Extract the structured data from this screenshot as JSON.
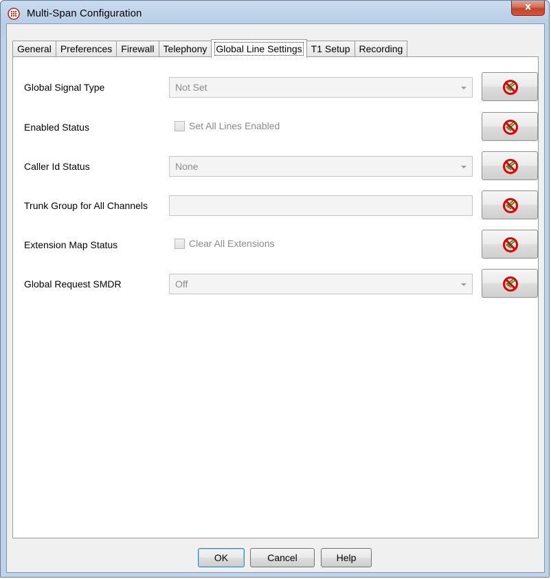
{
  "window": {
    "title": "Multi-Span Configuration",
    "close_label": "x"
  },
  "tabs": [
    {
      "label": "General"
    },
    {
      "label": "Preferences"
    },
    {
      "label": "Firewall"
    },
    {
      "label": "Telephony"
    },
    {
      "label": "Global Line Settings",
      "active": true
    },
    {
      "label": "T1 Setup"
    },
    {
      "label": "Recording"
    }
  ],
  "settings": {
    "global_signal_type": {
      "label": "Global Signal Type",
      "value": "Not Set"
    },
    "enabled_status": {
      "label": "Enabled Status",
      "checkbox_label": "Set All Lines Enabled",
      "checked": false
    },
    "caller_id_status": {
      "label": "Caller Id Status",
      "value": "None"
    },
    "trunk_group": {
      "label": "Trunk Group for All Channels",
      "value": ""
    },
    "extension_map_status": {
      "label": "Extension Map Status",
      "checkbox_label": "Clear All Extensions",
      "checked": false
    },
    "global_request_smdr": {
      "label": "Global Request SMDR",
      "value": "Off"
    }
  },
  "buttons": {
    "ok": "OK",
    "cancel": "Cancel",
    "help": "Help"
  },
  "icons": {
    "reset": "no-symbol-icon",
    "reset_color": "#e00000",
    "reset_inner_color": "#2e9a2e"
  },
  "colors": {
    "titlebar": "#bed2e9",
    "close_button": "#c4402a",
    "disabled_text": "#8a8a8a"
  }
}
